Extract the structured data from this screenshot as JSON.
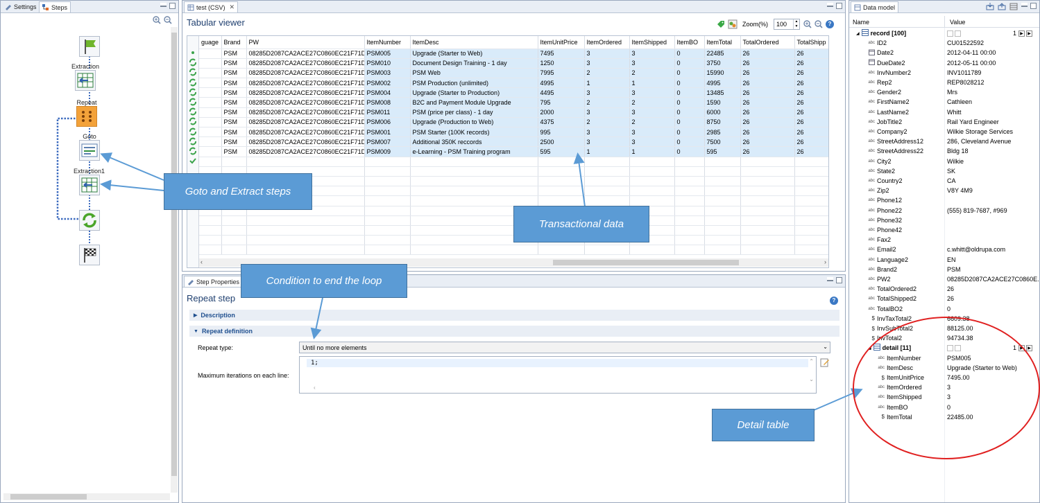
{
  "left_pane": {
    "tabs": [
      "Settings",
      "Steps"
    ],
    "steps": [
      "Extraction",
      "Repeat",
      "Goto",
      "Extraction1"
    ]
  },
  "editor": {
    "tab_title": "test (CSV)",
    "viewer_title": "Tabular viewer",
    "zoom_label": "Zoom(%)",
    "zoom_value": "100",
    "columns": [
      "guage",
      "Brand",
      "PW",
      "ItemNumber",
      "ItemDesc",
      "ItemUnitPrice",
      "ItemOrdered",
      "ItemShipped",
      "ItemBO",
      "ItemTotal",
      "TotalOrdered",
      "TotalShipp"
    ],
    "rows": [
      [
        "",
        "PSM",
        "08285D2087CA2ACE27C0860EC21F71D0",
        "PSM005",
        "Upgrade (Starter to Web)",
        "7495",
        "3",
        "3",
        "0",
        "22485",
        "26",
        "26"
      ],
      [
        "",
        "PSM",
        "08285D2087CA2ACE27C0860EC21F71D0",
        "PSM010",
        "Document Design Training - 1 day",
        "1250",
        "3",
        "3",
        "0",
        "3750",
        "26",
        "26"
      ],
      [
        "",
        "PSM",
        "08285D2087CA2ACE27C0860EC21F71D0",
        "PSM003",
        "PSM Web",
        "7995",
        "2",
        "2",
        "0",
        "15990",
        "26",
        "26"
      ],
      [
        "",
        "PSM",
        "08285D2087CA2ACE27C0860EC21F71D0",
        "PSM002",
        "PSM Production (unlimited)",
        "4995",
        "1",
        "1",
        "0",
        "4995",
        "26",
        "26"
      ],
      [
        "",
        "PSM",
        "08285D2087CA2ACE27C0860EC21F71D0",
        "PSM004",
        "Upgrade (Starter to Production)",
        "4495",
        "3",
        "3",
        "0",
        "13485",
        "26",
        "26"
      ],
      [
        "",
        "PSM",
        "08285D2087CA2ACE27C0860EC21F71D0",
        "PSM008",
        "B2C and Payment Module Upgrade",
        "795",
        "2",
        "2",
        "0",
        "1590",
        "26",
        "26"
      ],
      [
        "",
        "PSM",
        "08285D2087CA2ACE27C0860EC21F71D0",
        "PSM011",
        "PSM (price per class) - 1 day",
        "2000",
        "3",
        "3",
        "0",
        "6000",
        "26",
        "26"
      ],
      [
        "",
        "PSM",
        "08285D2087CA2ACE27C0860EC21F71D0",
        "PSM006",
        "Upgrade (Production to Web)",
        "4375",
        "2",
        "2",
        "0",
        "8750",
        "26",
        "26"
      ],
      [
        "",
        "PSM",
        "08285D2087CA2ACE27C0860EC21F71D0",
        "PSM001",
        "PSM Starter (100K records)",
        "995",
        "3",
        "3",
        "0",
        "2985",
        "26",
        "26"
      ],
      [
        "",
        "PSM",
        "08285D2087CA2ACE27C0860EC21F71D0",
        "PSM007",
        "Additional 350K reccords",
        "2500",
        "3",
        "3",
        "0",
        "7500",
        "26",
        "26"
      ],
      [
        "",
        "PSM",
        "08285D2087CA2ACE27C0860EC21F71D0",
        "PSM009",
        "e-Learning - PSM Training program",
        "595",
        "1",
        "1",
        "0",
        "595",
        "26",
        "26"
      ]
    ]
  },
  "step_properties": {
    "tab_title": "Step Properties",
    "title": "Repeat step",
    "description_label": "Description",
    "repeat_definition_label": "Repeat definition",
    "repeat_type_label": "Repeat type:",
    "repeat_type_value": "Until no more elements",
    "max_iter_label": "Maximum iterations on each line:",
    "max_iter_value": "1;"
  },
  "data_model": {
    "tab_title": "Data model",
    "col_name": "Name",
    "col_value": "Value",
    "record_label": "record [100]",
    "record_page": "1",
    "fields": [
      {
        "t": "abc",
        "n": "ID2",
        "v": "CU01522592"
      },
      {
        "t": "date",
        "n": "Date2",
        "v": "2012-04-11 00:00"
      },
      {
        "t": "date",
        "n": "DueDate2",
        "v": "2012-05-11 00:00"
      },
      {
        "t": "abc",
        "n": "InvNumber2",
        "v": "INV1011789"
      },
      {
        "t": "abc",
        "n": "Rep2",
        "v": "REP8028212"
      },
      {
        "t": "abc",
        "n": "Gender2",
        "v": "Mrs"
      },
      {
        "t": "abc",
        "n": "FirstName2",
        "v": "Cathleen"
      },
      {
        "t": "abc",
        "n": "LastName2",
        "v": "Whitt"
      },
      {
        "t": "abc",
        "n": "JobTitle2",
        "v": "Rail Yard Engineer"
      },
      {
        "t": "abc",
        "n": "Company2",
        "v": "Wilkie Storage Services"
      },
      {
        "t": "abc",
        "n": "StreetAddress12",
        "v": "286, Cleveland Avenue"
      },
      {
        "t": "abc",
        "n": "StreetAddress22",
        "v": "Bldg 18"
      },
      {
        "t": "abc",
        "n": "City2",
        "v": "Wilkie"
      },
      {
        "t": "abc",
        "n": "State2",
        "v": "SK"
      },
      {
        "t": "abc",
        "n": "Country2",
        "v": "CA"
      },
      {
        "t": "abc",
        "n": "Zip2",
        "v": "V8Y 4M9"
      },
      {
        "t": "abc",
        "n": "Phone12",
        "v": ""
      },
      {
        "t": "abc",
        "n": "Phone22",
        "v": "(555) 819-7687, #969"
      },
      {
        "t": "abc",
        "n": "Phone32",
        "v": ""
      },
      {
        "t": "abc",
        "n": "Phone42",
        "v": ""
      },
      {
        "t": "abc",
        "n": "Fax2",
        "v": ""
      },
      {
        "t": "abc",
        "n": "Email2",
        "v": "c.whitt@oldrupa.com"
      },
      {
        "t": "abc",
        "n": "Language2",
        "v": "EN"
      },
      {
        "t": "abc",
        "n": "Brand2",
        "v": "PSM"
      },
      {
        "t": "abc",
        "n": "PW2",
        "v": "08285D2087CA2ACE27C0860E..."
      },
      {
        "t": "abc",
        "n": "TotalOrdered2",
        "v": "26"
      },
      {
        "t": "abc",
        "n": "TotalShipped2",
        "v": "26"
      },
      {
        "t": "abc",
        "n": "TotalBO2",
        "v": "0"
      },
      {
        "t": "$",
        "n": "InvTaxTotal2",
        "v": "6609.38"
      },
      {
        "t": "$",
        "n": "InvSubTotal2",
        "v": "88125.00"
      },
      {
        "t": "$",
        "n": "InvTotal2",
        "v": "94734.38"
      }
    ],
    "detail_label": "detail [11]",
    "detail_page": "1",
    "detail_fields": [
      {
        "t": "abc",
        "n": "ItemNumber",
        "v": "PSM005"
      },
      {
        "t": "abc",
        "n": "ItemDesc",
        "v": "Upgrade (Starter to Web)"
      },
      {
        "t": "$",
        "n": "ItemUnitPrice",
        "v": "7495.00"
      },
      {
        "t": "abc",
        "n": "ItemOrdered",
        "v": "3"
      },
      {
        "t": "abc",
        "n": "ItemShipped",
        "v": "3"
      },
      {
        "t": "abc",
        "n": "ItemBO",
        "v": "0"
      },
      {
        "t": "$",
        "n": "ItemTotal",
        "v": "22485.00"
      }
    ]
  },
  "callouts": {
    "goto_extract": "Goto and Extract steps",
    "transactional": "Transactional data",
    "condition": "Condition to end the loop",
    "detail_table": "Detail table"
  },
  "colors": {
    "callout": "#5b9bd5",
    "selection": "#d9ebfa",
    "circle": "#e02020"
  }
}
